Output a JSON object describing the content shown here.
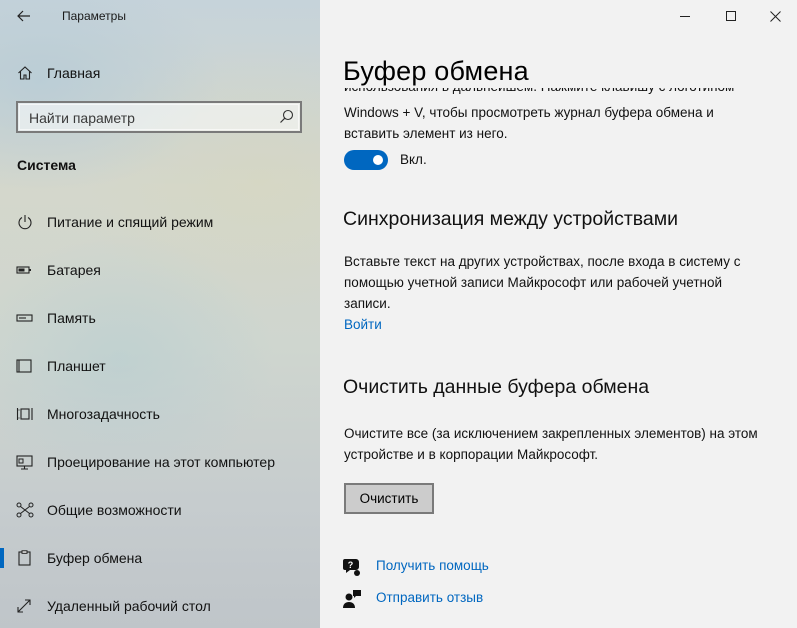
{
  "window": {
    "title": "Параметры",
    "controls": {
      "minimize_icon": "minimize-icon",
      "maximize_icon": "maximize-icon",
      "close_icon": "close-icon"
    }
  },
  "sidebar": {
    "home_label": "Главная",
    "search_placeholder": "Найти параметр",
    "section_title": "Система",
    "items": [
      {
        "label": "Питание и спящий режим",
        "icon": "power-icon",
        "active": false
      },
      {
        "label": "Батарея",
        "icon": "battery-icon",
        "active": false
      },
      {
        "label": "Память",
        "icon": "storage-icon",
        "active": false
      },
      {
        "label": "Планшет",
        "icon": "tablet-icon",
        "active": false
      },
      {
        "label": "Многозадачность",
        "icon": "multitasking-icon",
        "active": false
      },
      {
        "label": "Проецирование на этот компьютер",
        "icon": "projecting-icon",
        "active": false
      },
      {
        "label": "Общие возможности",
        "icon": "shared-experiences-icon",
        "active": false
      },
      {
        "label": "Буфер обмена",
        "icon": "clipboard-icon",
        "active": true
      },
      {
        "label": "Удаленный рабочий стол",
        "icon": "remote-desktop-icon",
        "active": false
      }
    ]
  },
  "main": {
    "page_title": "Буфер обмена",
    "history": {
      "clipped_text": "использования в дальнейшем. Нажмите клавишу с логотипом",
      "description": "Windows + V, чтобы просмотреть журнал буфера обмена и вставить элемент из него.",
      "toggle_state": "Вкл."
    },
    "sync": {
      "heading": "Синхронизация между устройствами",
      "description": "Вставьте текст на других устройствах, после входа в систему с помощью учетной записи Майкрософт или рабочей учетной записи.",
      "link": "Войти"
    },
    "clear": {
      "heading": "Очистить данные буфера обмена",
      "description": "Очистите все (за исключением закрепленных элементов) на этом устройстве и в корпорации Майкрософт.",
      "button": "Очистить"
    },
    "help_links": [
      {
        "label": "Получить помощь",
        "icon": "help-icon"
      },
      {
        "label": "Отправить отзыв",
        "icon": "feedback-icon"
      }
    ]
  },
  "colors": {
    "accent": "#0067c0",
    "content_bg": "#f2f2f2"
  }
}
